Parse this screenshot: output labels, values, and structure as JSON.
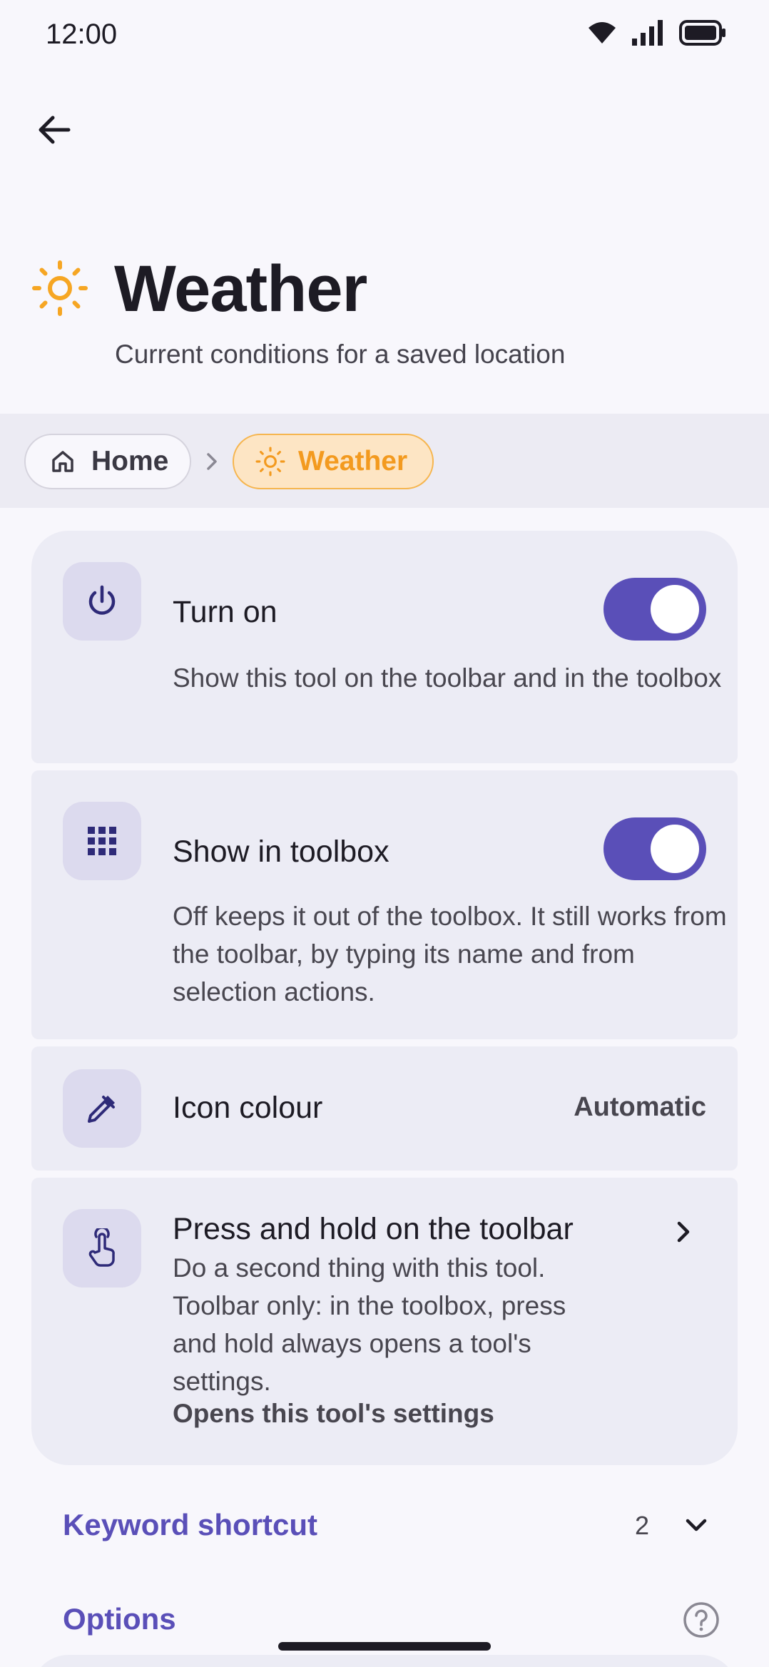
{
  "status_bar": {
    "time": "12:00",
    "icons": [
      "wifi-icon",
      "cellular-signal-icon",
      "battery-icon"
    ]
  },
  "top_bar": {
    "back_icon": "arrow-left-icon"
  },
  "header": {
    "icon": "sun-icon",
    "title": "Weather",
    "subtitle": "Current conditions for a saved location"
  },
  "breadcrumb": {
    "items": [
      {
        "label": "Home",
        "icon": "home-icon"
      },
      {
        "label": "Weather",
        "icon": "sun-icon",
        "selected": true
      }
    ],
    "separator_icon": "chevron-right-icon"
  },
  "settings": {
    "turn_on": {
      "icon": "power-icon",
      "title": "Turn on",
      "description": "Show this tool on the toolbar and in the toolbox",
      "enabled": true
    },
    "show_in_toolbox": {
      "icon": "grid-icon",
      "title": "Show in toolbox",
      "description": "Off keeps it out of the toolbox. It still works from the toolbar, by typing its name and from selection actions.",
      "enabled": true
    },
    "icon_colour": {
      "icon": "eyedropper-icon",
      "title": "Icon colour",
      "value": "Automatic"
    },
    "press_and_hold": {
      "icon": "touch-hand-icon",
      "title": "Press and hold on the toolbar",
      "description": "Do a second thing with this tool. Toolbar only: in the toolbox, press and hold always opens a tool's settings.",
      "value": "Opens this tool's settings"
    }
  },
  "sections": {
    "keyword_shortcut": {
      "label": "Keyword shortcut",
      "count": "2"
    },
    "options": {
      "label": "Options",
      "help_icon": "help-circle-icon"
    }
  },
  "colors": {
    "accent": "#5a4fb8",
    "sun": "#f6a623",
    "background": "#f8f7fc",
    "card": "#ececf5"
  }
}
